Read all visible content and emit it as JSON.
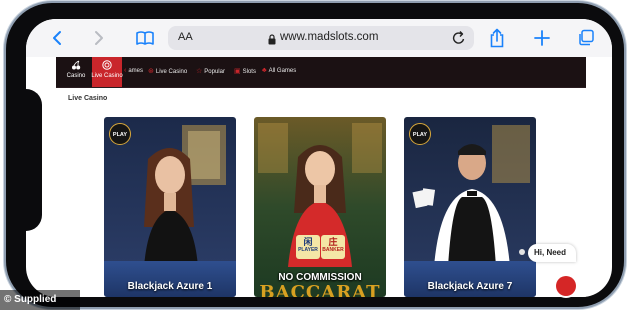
{
  "browser": {
    "text_size_label": "AA",
    "url": "www.madslots.com",
    "icons": [
      "back-icon",
      "forward-icon",
      "bookmarks-icon",
      "lock-icon",
      "reload-icon",
      "share-icon",
      "new-tab-icon",
      "tabs-icon"
    ]
  },
  "site_nav": {
    "tiles": [
      {
        "label": "Casino",
        "icon": "cherries-icon"
      },
      {
        "label": "Live Casino",
        "icon": "chip-icon"
      }
    ],
    "links": [
      {
        "label": "ames"
      },
      {
        "label": "Live Casino"
      },
      {
        "label": "Popular"
      },
      {
        "label": "Slots"
      },
      {
        "label": "All Games"
      }
    ]
  },
  "section": {
    "title": "Live Casino"
  },
  "games": [
    {
      "name": "Blackjack Azure 1",
      "badge": "PLAY"
    },
    {
      "name": "No Commission Baccarat",
      "subtitle": "NO COMMISSION",
      "logo_text": "BACCARAT",
      "player_glyph": "闲",
      "player_label": "PLAYER",
      "banker_glyph": "庄",
      "banker_label": "BANKER"
    },
    {
      "name": "Blackjack Azure 7",
      "badge": "PLAY"
    }
  ],
  "chat": {
    "bubble_text": "Hi, Need"
  },
  "credit": "© Supplied",
  "colors": {
    "brand_red": "#c9262b",
    "nav_background": "#1b1113",
    "browser_bar": "#f5f5f7",
    "url_field": "#e4e4e9",
    "ios_blue": "#1a82fb"
  }
}
